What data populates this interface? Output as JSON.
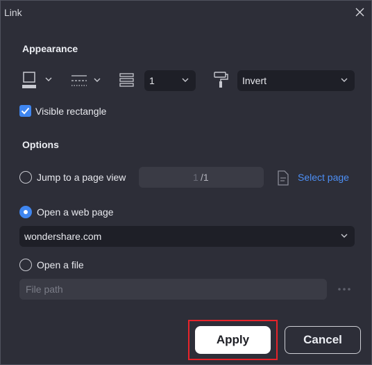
{
  "window": {
    "title": "Link"
  },
  "appearance": {
    "heading": "Appearance",
    "line_width_value": "1",
    "highlight_mode": "Invert",
    "visible_rectangle_label": "Visible rectangle",
    "visible_rectangle_checked": true
  },
  "options": {
    "heading": "Options",
    "jump_label": "Jump to a page view",
    "page_current": "1",
    "page_total": "/1",
    "select_page_label": "Select page",
    "web_label": "Open a web page",
    "web_value": "wondershare.com",
    "file_label": "Open a file",
    "file_placeholder": "File path",
    "selected": "Open a web page"
  },
  "buttons": {
    "apply": "Apply",
    "cancel": "Cancel"
  },
  "colors": {
    "accent": "#3f86f0",
    "link": "#4d8ff5",
    "highlight_border": "#e8232a"
  },
  "icons": [
    "close-icon",
    "border-color-icon",
    "line-style-icon",
    "line-width-icon",
    "highlight-brush-icon",
    "chevron-down-icon",
    "checkbox-check-icon",
    "page-icon",
    "more-icon"
  ]
}
